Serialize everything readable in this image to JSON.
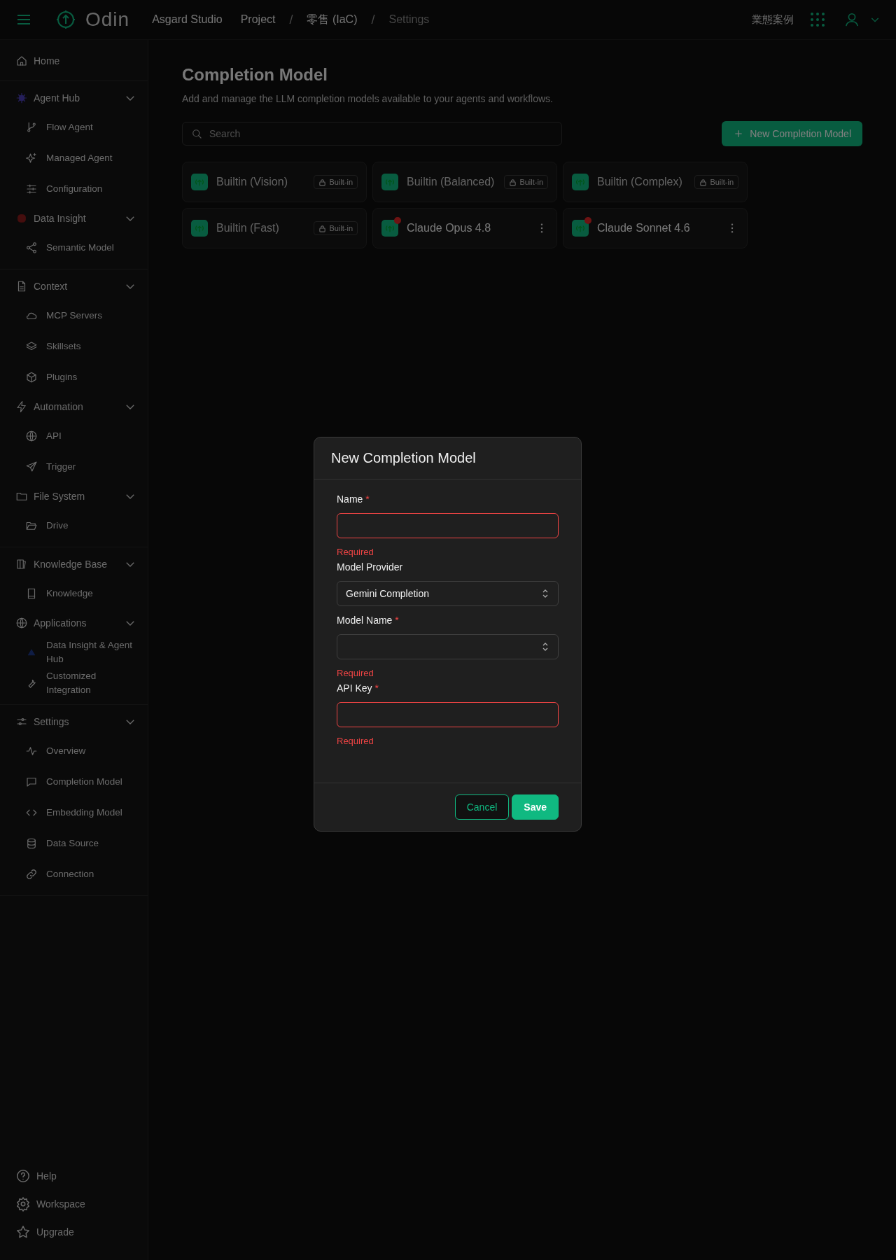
{
  "header": {
    "brand": "Odin",
    "breadcrumbs": [
      {
        "label": "Asgard Studio"
      },
      {
        "label": "Project"
      },
      {
        "label": "零售 (IaC)",
        "separator": "/"
      },
      {
        "label": "Settings",
        "separator": "/"
      }
    ],
    "right_link": "業態案例"
  },
  "sidebar": {
    "sections": [
      [
        {
          "label": "Home"
        }
      ],
      [
        {
          "label": "Agent Hub",
          "expanded": true,
          "children": [
            {
              "label": "Flow Agent"
            },
            {
              "label": "Managed Agent"
            },
            {
              "label": "Configuration"
            }
          ]
        },
        {
          "label": "Data Insight",
          "expanded": true,
          "children": [
            {
              "label": "Semantic Model"
            }
          ]
        }
      ],
      [
        {
          "label": "Context",
          "expanded": true,
          "children": [
            {
              "label": "MCP Servers"
            },
            {
              "label": "Skillsets"
            },
            {
              "label": "Plugins"
            }
          ]
        },
        {
          "label": "Automation",
          "expanded": true,
          "children": [
            {
              "label": "API"
            },
            {
              "label": "Trigger"
            }
          ]
        },
        {
          "label": "File System",
          "expanded": true,
          "children": [
            {
              "label": "Drive"
            }
          ]
        }
      ],
      [
        {
          "label": "Knowledge Base",
          "expanded": true,
          "children": [
            {
              "label": "Knowledge"
            }
          ]
        },
        {
          "label": "Applications",
          "expanded": true,
          "children": [
            {
              "label": "Data Insight & Agent Hub"
            },
            {
              "label": "Customized Integration"
            }
          ]
        }
      ],
      [
        {
          "label": "Settings",
          "expanded": true,
          "children": [
            {
              "label": "Overview"
            },
            {
              "label": "Completion Model"
            },
            {
              "label": "Embedding Model"
            },
            {
              "label": "Data Source"
            },
            {
              "label": "Connection"
            }
          ]
        }
      ]
    ],
    "footer": [
      {
        "label": "Help"
      },
      {
        "label": "Workspace"
      },
      {
        "label": "Upgrade"
      }
    ]
  },
  "page": {
    "title": "Completion Model",
    "subtitle": "Add and manage the LLM completion models available to your agents and workflows.",
    "search": {
      "placeholder": "Search"
    },
    "new_button": "New Completion Model",
    "models": [
      {
        "name": "Builtin (Vision)",
        "kind": "builtin",
        "badge": "Built-in"
      },
      {
        "name": "Builtin (Balanced)",
        "kind": "builtin",
        "badge": "Built-in"
      },
      {
        "name": "Builtin (Complex)",
        "kind": "builtin",
        "badge": "Built-in"
      },
      {
        "name": "Builtin (Fast)",
        "kind": "builtin",
        "badge": "Built-in"
      },
      {
        "name": "Claude Opus 4.8",
        "kind": "custom"
      },
      {
        "name": "Claude Sonnet 4.6",
        "kind": "custom"
      }
    ]
  },
  "dialog": {
    "title": "New Completion Model",
    "fields": [
      {
        "label": "Name",
        "required_mark": "*",
        "kind": "text",
        "invalid": true,
        "error": "Required"
      },
      {
        "label": "Model Provider",
        "kind": "select",
        "invalid": false,
        "value": "Gemini Completion"
      },
      {
        "label": "Model Name",
        "required_mark": "*",
        "kind": "select",
        "invalid": false,
        "error": "Required"
      },
      {
        "label": "API Key",
        "required_mark": "*",
        "kind": "text",
        "invalid": true,
        "error": "Required"
      }
    ],
    "buttons": [
      {
        "label": "Cancel",
        "kind": "secondary"
      },
      {
        "label": "Save",
        "kind": "primary"
      }
    ]
  }
}
